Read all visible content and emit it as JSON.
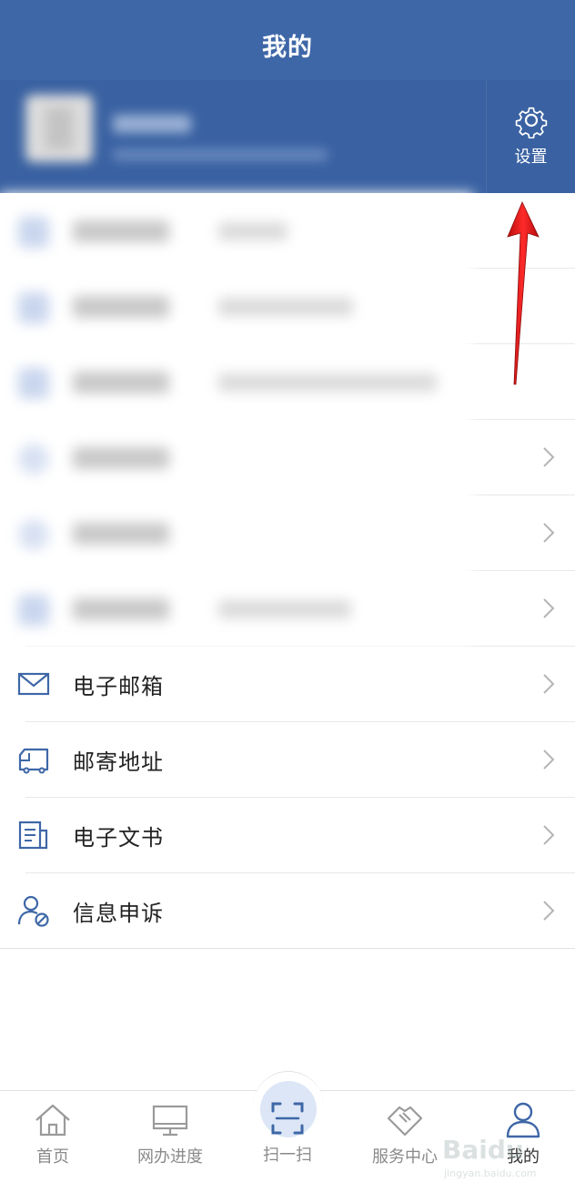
{
  "header": {
    "title": "我的"
  },
  "profile": {
    "settings_label": "设置"
  },
  "menu": [
    {
      "label": "电子邮箱",
      "icon": "envelope-icon"
    },
    {
      "label": "邮寄地址",
      "icon": "delivery-truck-icon"
    },
    {
      "label": "电子文书",
      "icon": "document-icon"
    },
    {
      "label": "信息申诉",
      "icon": "user-appeal-icon"
    }
  ],
  "tabs": [
    {
      "label": "首页",
      "icon": "home-icon"
    },
    {
      "label": "网办进度",
      "icon": "monitor-icon"
    },
    {
      "label": "扫一扫",
      "icon": "scan-icon"
    },
    {
      "label": "服务中心",
      "icon": "handshake-icon"
    },
    {
      "label": "我的",
      "icon": "user-icon",
      "active": true
    }
  ],
  "watermark": {
    "text": "Baidu",
    "sub": "jingyan.baidu.com"
  },
  "colors": {
    "primary": "#3e67a7",
    "annotation_arrow": "#e01818"
  }
}
